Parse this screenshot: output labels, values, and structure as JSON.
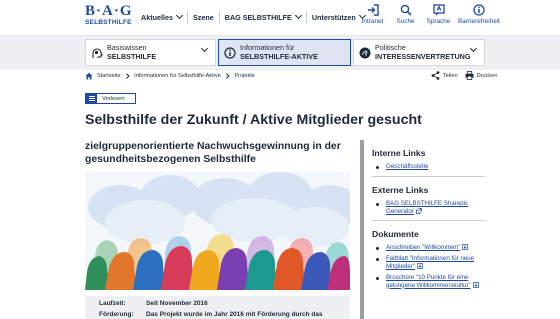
{
  "logo": {
    "top": "B·A·G",
    "bottom": "SELBSTHILFE"
  },
  "mainnav": [
    "Aktuelles",
    "Szene",
    "BAG SELBSTHILFE",
    "Unterstützen"
  ],
  "utilnav": [
    {
      "label": "Intranet",
      "icon": "login-icon"
    },
    {
      "label": "Suche",
      "icon": "search-icon"
    },
    {
      "label": "Sprache",
      "icon": "language-icon"
    },
    {
      "label": "Barrierefreiheit",
      "icon": "info-icon"
    }
  ],
  "audience": [
    {
      "line1": "Basiswissen",
      "line2": "SELBSTHILFE",
      "icon": "head-icon",
      "active": false
    },
    {
      "line1": "Informationen für",
      "line2": "SELBSTHILFE-AKTIVE",
      "icon": "info-icon",
      "active": true
    },
    {
      "line1": "Politische",
      "line2": "INTERESSENVERTRETUNG",
      "icon": "political-icon",
      "active": false
    }
  ],
  "breadcrumb": [
    "Startseite",
    "Informationen für Selbsthilfe-Aktive",
    "Projekte"
  ],
  "actions": {
    "share": "Teilen",
    "print": "Drucken"
  },
  "vorlesen": "Vorlesen",
  "title": "Selbsthilfe der Zukunft / Aktive Mitglieder gesucht",
  "subtitle": "zielgruppenorientierte Nachwuchsgewinnung in der gesundheitsbezogenen Selbsthilfe",
  "info": {
    "laufzeit_label": "Laufzeit:",
    "laufzeit_value": "Seit November 2016",
    "foerderung_label": "Förderung:",
    "foerderung_value": "Das Projekt wurde im Jahr 2016 mit Förderung durch das"
  },
  "sidebar": {
    "interne_title": "Interne Links",
    "interne": [
      "Geschäftsstelle"
    ],
    "externe_title": "Externe Links",
    "externe": [
      "BAG SELBSTHILFE Sharepic Generator"
    ],
    "dokumente_title": "Dokumente",
    "dokumente": [
      "Anschreiben \"Willkommen\"",
      "Faltblatt \"Informationen für neue Mitglieder\"",
      "Broschüre \"10 Punkte für eine gelungene Willkommenskultur\""
    ]
  },
  "colors": {
    "brand": "#1f4aa0",
    "text": "#1d2a3a",
    "bar": "#eef0f3"
  }
}
